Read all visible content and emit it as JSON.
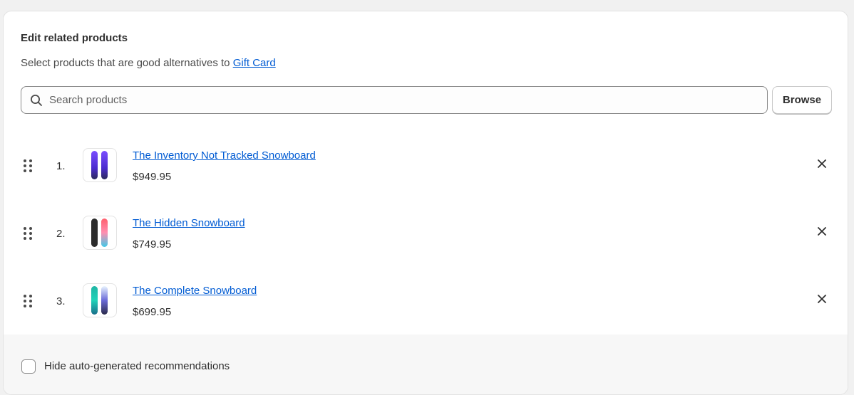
{
  "modal": {
    "title": "Edit related products",
    "subtitle_prefix": "Select products that are good alternatives to",
    "subtitle_link": "Gift Card"
  },
  "search": {
    "placeholder": "Search products",
    "value": "",
    "browse_label": "Browse"
  },
  "products": [
    {
      "index": "1.",
      "name": "The Inventory Not Tracked Snowboard",
      "price": "$949.95",
      "thumb_icon": "snowboard-purple-icon"
    },
    {
      "index": "2.",
      "name": "The Hidden Snowboard",
      "price": "$749.95",
      "thumb_icon": "snowboard-gradient-icon"
    },
    {
      "index": "3.",
      "name": "The Complete Snowboard",
      "price": "$699.95",
      "thumb_icon": "snowboard-teal-icon"
    }
  ],
  "footer": {
    "checkbox_label": "Hide auto-generated recommendations",
    "checked": false
  },
  "colors": {
    "link": "#005bd3",
    "text": "#303030",
    "border": "#e3e3e3",
    "footer_bg": "#f7f7f7"
  }
}
